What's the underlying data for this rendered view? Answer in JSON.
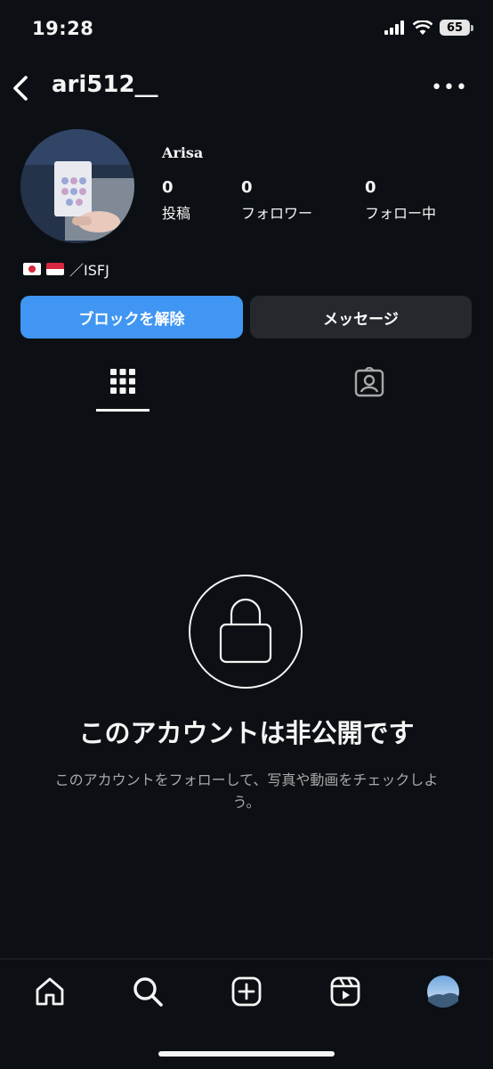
{
  "status_bar": {
    "time": "19:28",
    "battery": "65"
  },
  "header": {
    "username": "ari512__",
    "more_label": "•••"
  },
  "profile": {
    "display_name": "Arisa",
    "stats": [
      {
        "value": "0",
        "label": "投稿"
      },
      {
        "value": "0",
        "label": "フォロワー"
      },
      {
        "value": "0",
        "label": "フォロー中"
      }
    ],
    "bio_text": "／ISFJ"
  },
  "actions": {
    "unblock_label": "ブロックを解除",
    "message_label": "メッセージ"
  },
  "private_notice": {
    "title": "このアカウントは非公開です",
    "description": "このアカウントをフォローして、写真や動画をチェックしよう。"
  },
  "colors": {
    "accent": "#4096f2",
    "background": "#0c1014",
    "secondary_button": "#25292e"
  },
  "icons": {
    "tabs": [
      "grid-icon",
      "tagged-icon"
    ],
    "nav": [
      "home-icon",
      "search-icon",
      "create-icon",
      "reels-icon",
      "profile-avatar"
    ]
  }
}
